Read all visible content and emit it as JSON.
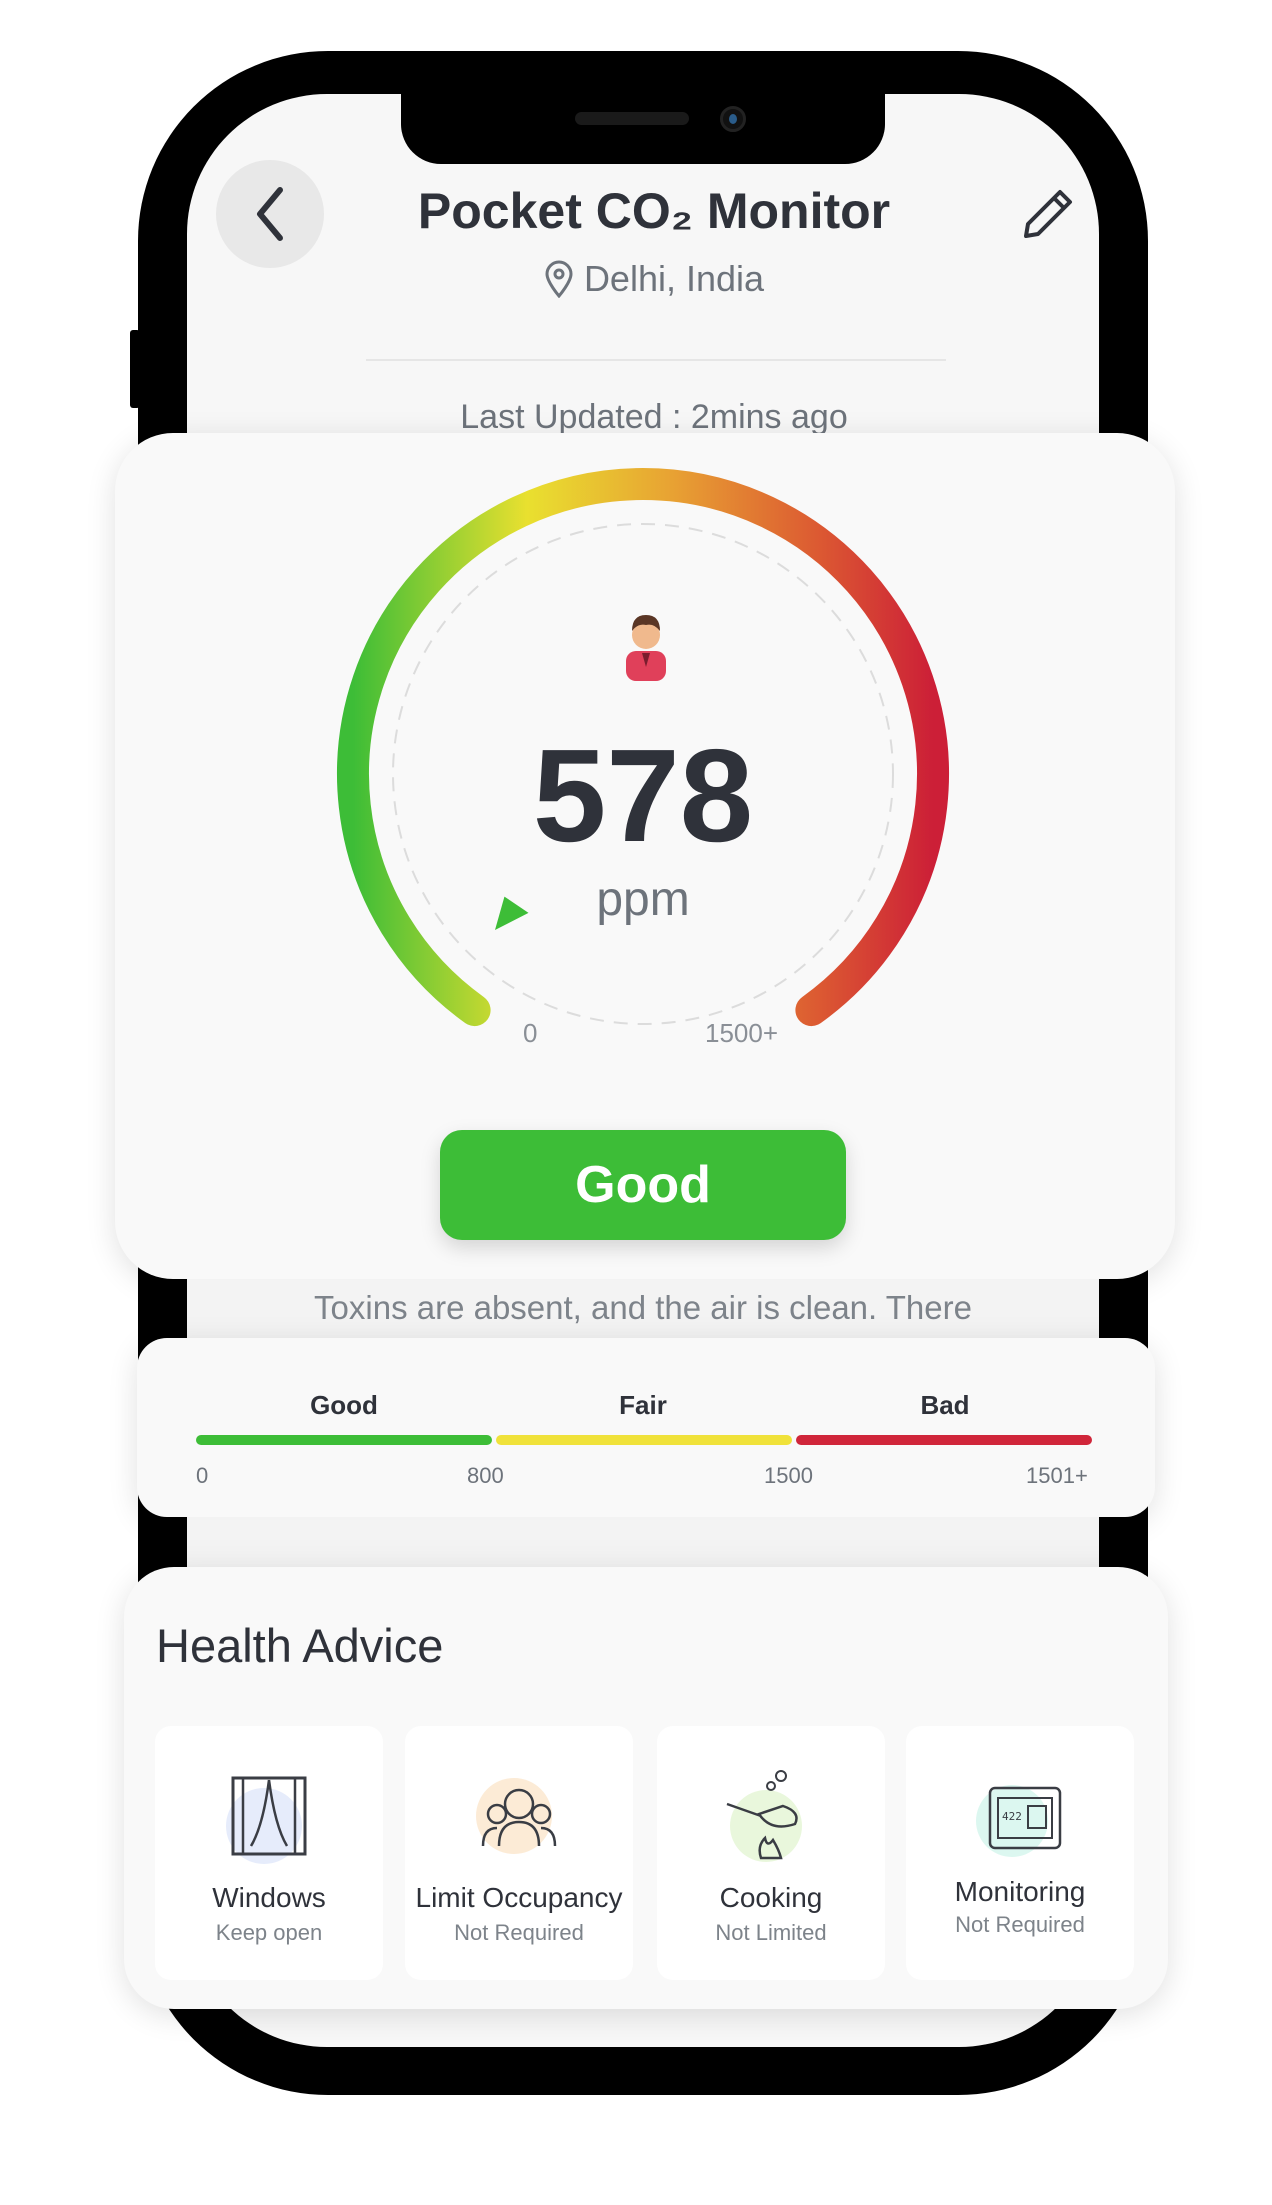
{
  "header": {
    "title": "Pocket CO₂ Monitor",
    "location": "Delhi, India",
    "last_updated": "Last Updated : 2mins ago"
  },
  "gauge": {
    "value": "578",
    "unit": "ppm",
    "min_label": "0",
    "max_label": "1500+",
    "reading": 578,
    "max": 1500,
    "status": "Good",
    "description": "Toxins are absent, and the air is clean. There"
  },
  "scale": {
    "levels": [
      {
        "label": "Good",
        "color": "#3dbd37"
      },
      {
        "label": "Fair",
        "color": "#f0e23a"
      },
      {
        "label": "Bad",
        "color": "#d0263a"
      }
    ],
    "ticks": [
      "0",
      "800",
      "1500",
      "1501+"
    ]
  },
  "health": {
    "title": "Health Advice",
    "items": [
      {
        "label": "Windows",
        "sub": "Keep open",
        "icon": "window-icon",
        "color": "#e6ecfb"
      },
      {
        "label": "Limit Occupancy",
        "sub": "Not Required",
        "icon": "people-icon",
        "color": "#fcebd6"
      },
      {
        "label": "Cooking",
        "sub": "Not Limited",
        "icon": "cooking-pan-icon",
        "color": "#e9f7dc"
      },
      {
        "label": "Monitoring",
        "sub": "Not Required",
        "icon": "monitor-device-icon",
        "color": "#dcf7f0"
      }
    ]
  }
}
